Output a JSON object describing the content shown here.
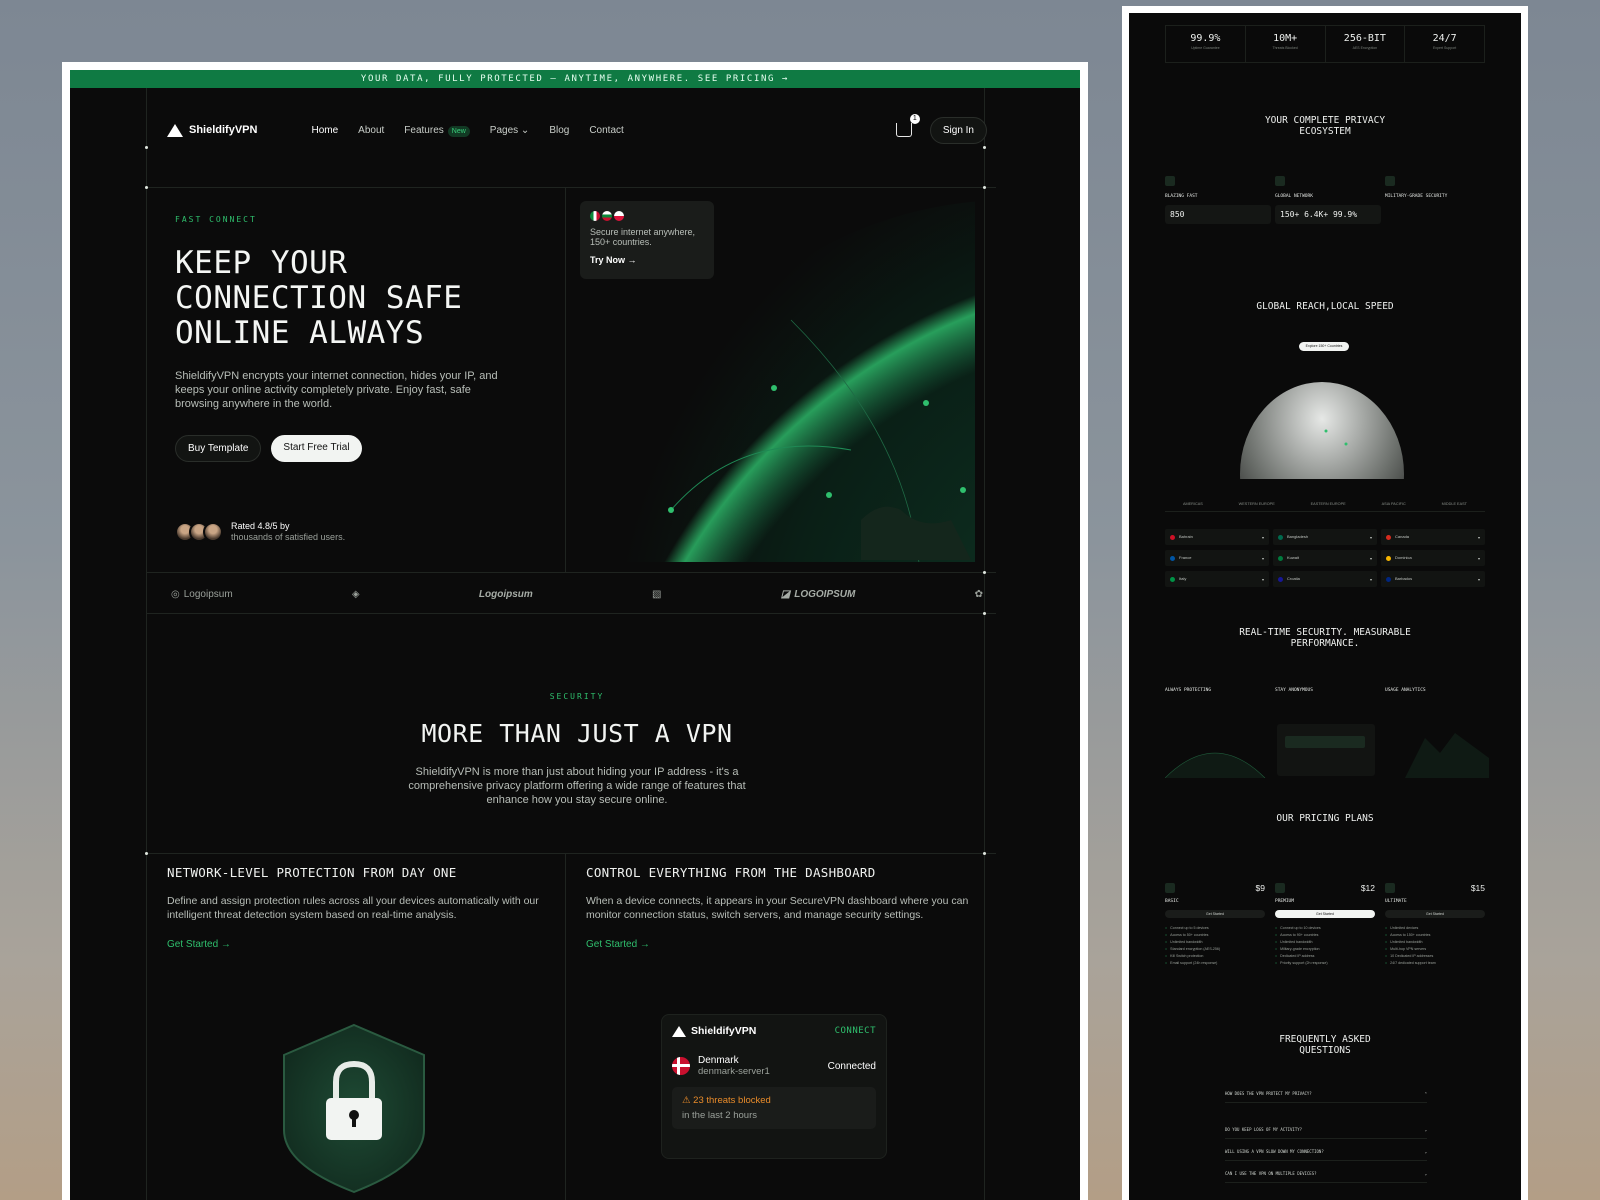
{
  "banner": "YOUR DATA, FULLY PROTECTED — ANYTIME, ANYWHERE. SEE PRICING →",
  "brand": "ShieldifyVPN",
  "nav": {
    "links": [
      "Home",
      "About",
      "Features",
      "Pages",
      "Blog",
      "Contact"
    ],
    "new_tag": "New",
    "cart_count": "1",
    "sign_in": "Sign In"
  },
  "hero": {
    "eyebrow": "FAST CONNECT",
    "title": "KEEP YOUR CONNECTION SAFE ONLINE ALWAYS",
    "body": "ShieldifyVPN encrypts your internet connection, hides your IP, and keeps your online activity completely private. Enjoy fast, safe browsing anywhere in the world.",
    "btn_buy": "Buy Template",
    "btn_trial": "Start Free Trial",
    "rating_line1": "Rated 4.8/5 by",
    "rating_line2": "thousands of satisfied users."
  },
  "popup": {
    "text": "Secure internet anywhere, 150+ countries.",
    "cta": "Try Now →"
  },
  "logos": [
    "Logoipsum",
    "Logoipsum",
    "LOGOIPSUM"
  ],
  "security": {
    "eyebrow": "SECURITY",
    "title": "MORE THAN JUST A VPN",
    "body": "ShieldifyVPN is more than just about hiding your IP address - it's a comprehensive privacy platform offering a wide range of features that enhance how you stay secure online."
  },
  "features": [
    {
      "title": "NETWORK-LEVEL PROTECTION FROM DAY ONE",
      "body": "Define and assign protection rules across all your devices automatically with our intelligent threat detection system based on real-time analysis.",
      "link": "Get Started →"
    },
    {
      "title": "CONTROL EVERYTHING FROM THE DASHBOARD",
      "body": "When a device connects, it appears in your SecureVPN dashboard where you can monitor connection status, switch servers, and manage security settings.",
      "link": "Get Started →"
    }
  ],
  "dashboard": {
    "brand": "ShieldifyVPN",
    "connect": "CONNECT",
    "country": "Denmark",
    "server": "denmark-server1",
    "status": "Connected",
    "alert": "23 threats blocked",
    "alert_sub": "in the last 2 hours"
  },
  "right": {
    "stats": [
      {
        "value": "99.9%",
        "label": "Uptime Guarantee"
      },
      {
        "value": "10M+",
        "label": "Threats Blocked"
      },
      {
        "value": "256-BIT",
        "label": "AES Encryption"
      },
      {
        "value": "24/7",
        "label": "Expert Support"
      }
    ],
    "ecosystem_title": "YOUR COMPLETE PRIVACY ECOSYSTEM",
    "ecosystem_cards": [
      {
        "title": "BLAZING FAST",
        "metric": "850"
      },
      {
        "title": "GLOBAL NETWORK",
        "metric": "150+  6.4K+  99.9%"
      },
      {
        "title": "MILITARY-GRADE SECURITY",
        "metric": ""
      }
    ],
    "reach_title": "GLOBAL REACH,LOCAL SPEED",
    "reach_cta": "Explore 150+ Countries",
    "regions": [
      "AMERICAS",
      "WESTERN EUROPE",
      "EASTERN EUROPE",
      "ASIA PACIFIC",
      "MIDDLE EAST"
    ],
    "countries": [
      [
        "Bahrain",
        "Bangladesh",
        "Canada"
      ],
      [
        "France",
        "Kuwait",
        "Dominica"
      ],
      [
        "Italy",
        "Croatia",
        "Barbados"
      ]
    ],
    "perf_title": "REAL-TIME SECURITY. MEASURABLE PERFORMANCE.",
    "perf_cards": [
      "ALWAYS PROTECTING",
      "STAY ANONYMOUS",
      "USAGE ANALYTICS"
    ],
    "pricing_title": "OUR PRICING PLANS",
    "plans": [
      {
        "name": "BASIC",
        "price": "$9",
        "cta": "Get Started",
        "features": [
          "Connect up to 5 devices",
          "Access to 50+ countries",
          "Unlimited bandwidth",
          "Standard encryption (AES-256)",
          "Kill Switch protection",
          "Email support (24h response)"
        ]
      },
      {
        "name": "PREMIUM",
        "price": "$12",
        "cta": "Get Started",
        "features": [
          "Connect up to 10 devices",
          "Access to 90+ countries",
          "Unlimited bandwidth",
          "Military-grade encryption",
          "Dedicated IP address",
          "Priority support (2h response)"
        ]
      },
      {
        "name": "ULTIMATE",
        "price": "$15",
        "cta": "Get Started",
        "features": [
          "Unlimited devices",
          "Access to 150+ countries",
          "Unlimited bandwidth",
          "Multi-hop VPN servers",
          "10 Dedicated IP addresses",
          "24/7 dedicated support team"
        ]
      }
    ],
    "faq_title": "FREQUENTLY ASKED QUESTIONS",
    "faqs": [
      "HOW DOES THE VPN PROTECT MY PRIVACY?",
      "DO YOU KEEP LOGS OF MY ACTIVITY?",
      "WILL USING A VPN SLOW DOWN MY CONNECTION?",
      "CAN I USE THE VPN ON MULTIPLE DEVICES?"
    ]
  },
  "colors": {
    "accent": "#2fbf6d",
    "banner": "#0f7a43",
    "background": "#0b0b0b"
  }
}
